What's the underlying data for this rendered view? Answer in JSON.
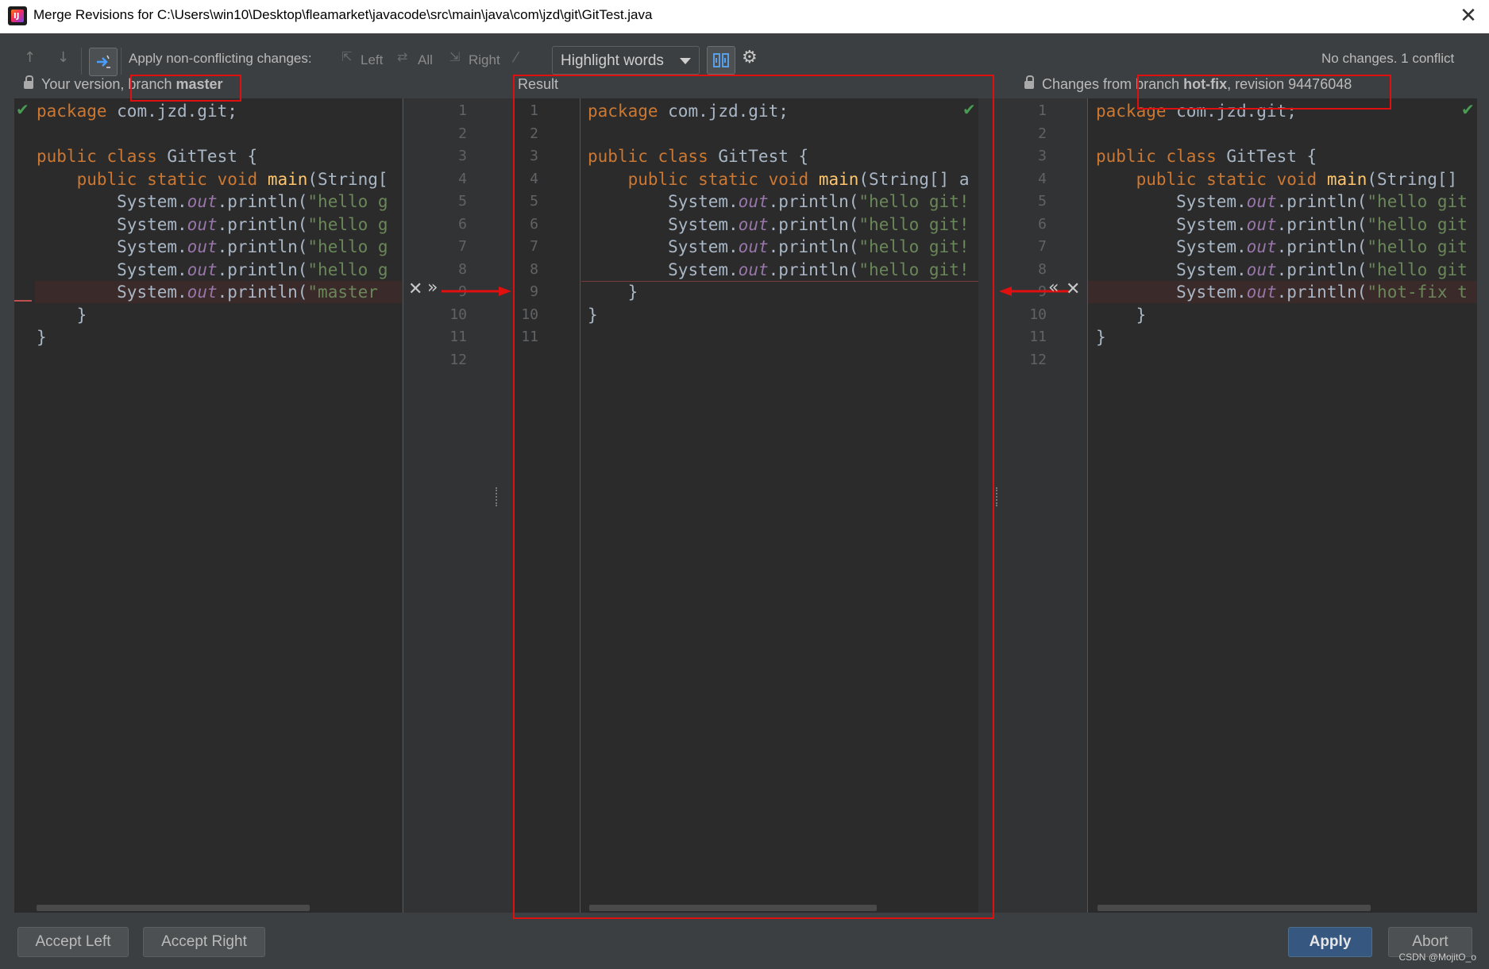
{
  "window": {
    "title": "Merge Revisions for C:\\Users\\win10\\Desktop\\fleamarket\\javacode\\src\\main\\java\\com\\jzd\\git\\GitTest.java"
  },
  "toolbar": {
    "apply_label": "Apply non-conflicting changes:",
    "left_label": "Left",
    "all_label": "All",
    "right_label": "Right",
    "highlight_value": "Highlight words",
    "status": "No changes. 1 conflict"
  },
  "headers": {
    "left_prefix": "Your version,",
    "left_branch_word": "branch",
    "left_branch": "master",
    "center": "Result",
    "right_prefix": "Changes from",
    "right_branch_word": "branch",
    "right_branch": "hot-fix",
    "right_revision": ", revision 94476048"
  },
  "line_numbers": {
    "left": [
      "1",
      "2",
      "3",
      "4",
      "5",
      "6",
      "7",
      "8",
      "9",
      "10",
      "11",
      "12"
    ],
    "center": [
      "1",
      "2",
      "3",
      "4",
      "5",
      "6",
      "7",
      "8",
      "9",
      "10",
      "11"
    ],
    "right": [
      "1",
      "2",
      "3",
      "4",
      "5",
      "6",
      "7",
      "8",
      "9",
      "10",
      "11",
      "12"
    ]
  },
  "code": {
    "package_kw": "package",
    "package_name": " com.jzd.git;",
    "public_class": "public class",
    "class_name": " GitTest {",
    "pss": "public static void",
    "main": "main",
    "main_args_left": "(String[",
    "main_args_center": "(String[] a",
    "main_args_right": "(String[]",
    "sys": "System.",
    "out": "out",
    "println": ".println(",
    "hello_left": "\"hello g",
    "hello_center": "\"hello git!",
    "hello_right": "\"hello git",
    "master_str": "\"master ",
    "hotfix_str": "\"hot-fix t",
    "close_inner": "}",
    "close_outer": "}"
  },
  "buttons": {
    "accept_left": "Accept Left",
    "accept_right": "Accept Right",
    "apply": "Apply",
    "abort": "Abort"
  },
  "watermark": "CSDN @MojitO_o"
}
